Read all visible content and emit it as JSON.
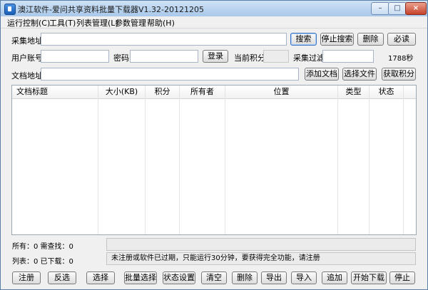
{
  "window": {
    "title": "澳江软件-爱问共享资料批量下载器V1.32-20121205",
    "min_glyph": "–",
    "max_glyph": "□",
    "close_glyph": "×"
  },
  "menu": [
    "运行控制(C)",
    "工具(T)",
    "列表管理(L)",
    "参数管理",
    "帮助(H)"
  ],
  "form": {
    "collect_url_label": "采集地址",
    "collect_url_value": "",
    "search_btn": "搜索",
    "stop_search_btn": "停止搜索",
    "delete_btn": "删除",
    "bitou_btn": "必读",
    "user_label": "用户账号",
    "user_value": "",
    "password_label": "密码",
    "password_value": "",
    "login_btn": "登录",
    "points_label": "当前积分",
    "points_value": "",
    "filter_label": "采集过滤",
    "filter_value": "",
    "seconds_value": "1788秒",
    "doc_url_label": "文档地址",
    "doc_url_value": "",
    "add_doc_btn": "添加文档",
    "choose_file_btn": "选择文件",
    "get_points_btn": "获取积分"
  },
  "table": {
    "columns": [
      "文档标题",
      "大小(KB)",
      "积分",
      "所有者",
      "位置",
      "类型",
      "状态"
    ],
    "rows": []
  },
  "status": {
    "total_label": "所有：0 需查找：0",
    "list_label": "列表：0 已下载：0",
    "message": "未注册或软件已过期，只能运行30分钟，要获得完全功能，请注册"
  },
  "bottom_buttons": [
    "注册",
    "反选",
    "选择",
    "批量选择",
    "状态设置",
    "清空",
    "删除",
    "导出",
    "导入",
    "追加",
    "开始下载",
    "停止"
  ]
}
